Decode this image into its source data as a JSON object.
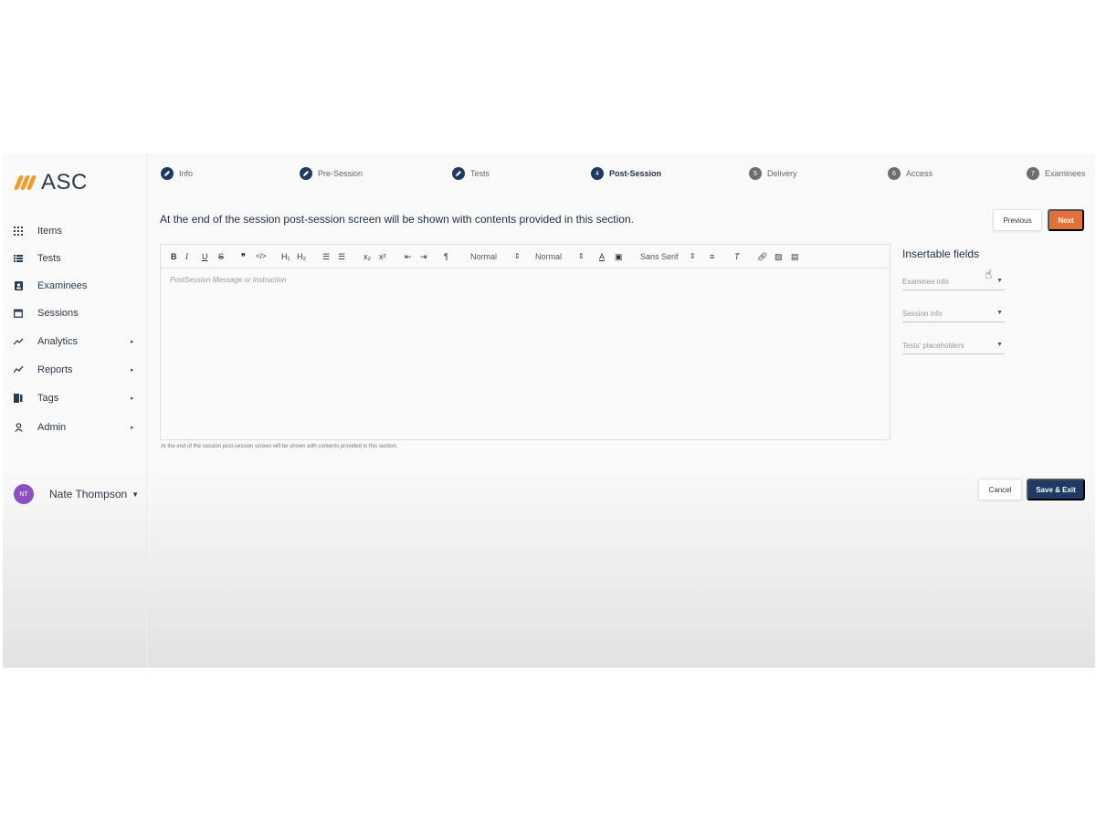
{
  "app": {
    "logo": "ASC"
  },
  "sidebar": {
    "items": [
      {
        "label": "Items",
        "icon": "grid-icon",
        "has_arrow": false
      },
      {
        "label": "Tests",
        "icon": "list-icon",
        "has_arrow": false
      },
      {
        "label": "Examinees",
        "icon": "person-badge-icon",
        "has_arrow": false
      },
      {
        "label": "Sessions",
        "icon": "calendar-icon",
        "has_arrow": false
      },
      {
        "label": "Analytics",
        "icon": "trending-up-icon",
        "has_arrow": true
      },
      {
        "label": "Reports",
        "icon": "chart-line-icon",
        "has_arrow": true
      },
      {
        "label": "Tags",
        "icon": "bookmark-icon",
        "has_arrow": true
      },
      {
        "label": "Admin",
        "icon": "user-icon",
        "has_arrow": true
      }
    ],
    "user": {
      "initials": "NT",
      "name": "Nate Thompson",
      "avatar_color": "#8e4fc0"
    }
  },
  "stepper": {
    "steps": [
      {
        "number": "",
        "label": "Info",
        "state": "done"
      },
      {
        "number": "",
        "label": "Pre-Session",
        "state": "done"
      },
      {
        "number": "",
        "label": "Tests",
        "state": "done"
      },
      {
        "number": "4",
        "label": "Post-Session",
        "state": "active"
      },
      {
        "number": "5",
        "label": "Delivery",
        "state": "todo"
      },
      {
        "number": "6",
        "label": "Access",
        "state": "todo"
      },
      {
        "number": "7",
        "label": "Examinees",
        "state": "todo"
      }
    ]
  },
  "main": {
    "title": "At the end of the session post-session screen will be shown with contents provided in this section.",
    "previous_label": "Previous",
    "next_label": "Next",
    "editor": {
      "placeholder": "PostSession Message or Instruction",
      "help_text": "At the end of the session post-session screen will be shown with contents provided in this section.",
      "toolbar": {
        "header_select": "Normal",
        "size_select": "Normal",
        "font_select": "Sans Serif"
      }
    },
    "insertable": {
      "title": "Insertable fields",
      "fields": [
        "Examinee info",
        "Session info",
        "Tests' placeholders"
      ]
    },
    "cancel_label": "Cancel",
    "save_label": "Save & Exit"
  },
  "colors": {
    "accent_orange": "#e2703a",
    "navy": "#1f3a63",
    "logo_orange": "#f29b2e"
  }
}
